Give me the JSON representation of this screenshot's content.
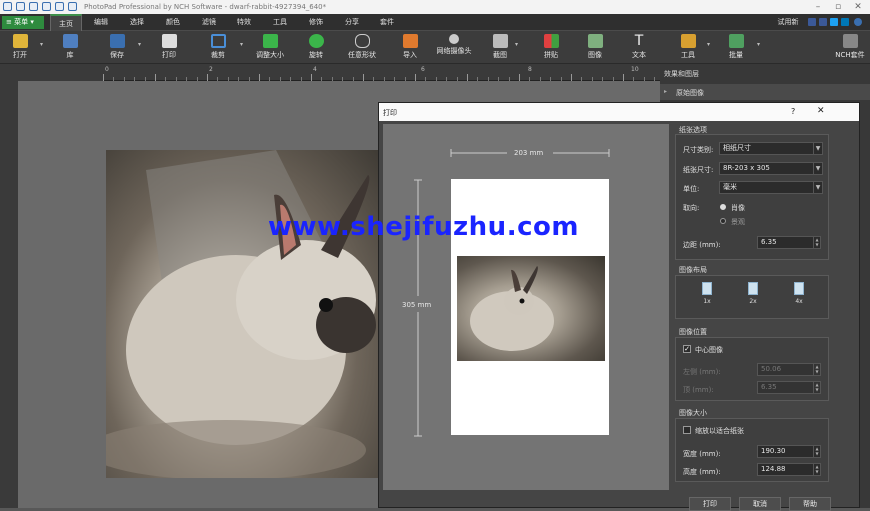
{
  "window": {
    "title": "PhotoPad Professional by NCH Software - dwarf-rabbit-4927394_640*"
  },
  "menubar": {
    "menu_label": "菜单",
    "tabs": [
      "主页",
      "编辑",
      "选择",
      "颜色",
      "滤镜",
      "特效",
      "工具",
      "修饰",
      "分享",
      "套件"
    ],
    "trial_label": "试用新"
  },
  "toolbar": {
    "open": "打开",
    "library": "库",
    "save": "保存",
    "print": "打印",
    "crop": "裁剪",
    "resize": "调整大小",
    "rotate": "旋转",
    "free_shape": "任意形状",
    "import": "导入",
    "webcam": "网络摄像头",
    "screenshot": "截图",
    "collage": "拼贴",
    "image": "图像",
    "text": "文本",
    "tools": "工具",
    "batch": "批量",
    "nch_suite": "NCH套件"
  },
  "ruler": {
    "labels": [
      "0",
      "2",
      "4",
      "6",
      "8",
      "10"
    ]
  },
  "effects_panel": {
    "title": "效果和图层",
    "original_image": "原始图像"
  },
  "dialog": {
    "title": "打印",
    "help": "?",
    "close": "✕",
    "preview": {
      "width_label": "203 mm",
      "height_label": "305 mm"
    },
    "paper_options": {
      "title": "纸张选项",
      "size_type_label": "尺寸类别:",
      "size_type_value": "相纸尺寸",
      "paper_size_label": "纸张尺寸:",
      "paper_size_value": "8R-203 x 305",
      "unit_label": "单位:",
      "unit_value": "毫米",
      "orientation_label": "取向:",
      "portrait": "肖像",
      "landscape": "景观",
      "margin_label": "边距 (mm):",
      "margin_value": "6.35"
    },
    "layout": {
      "title": "图像布局",
      "options": [
        "1x",
        "2x",
        "4x"
      ]
    },
    "position": {
      "title": "图像位置",
      "center_label": "中心图像",
      "left_label": "左侧 (mm):",
      "left_value": "50.06",
      "top_label": "顶 (mm):",
      "top_value": "6.35"
    },
    "size": {
      "title": "图像大小",
      "fit_label": "缩放以适合纸张",
      "width_label": "宽度 (mm):",
      "width_value": "190.30",
      "height_label": "高度 (mm):",
      "height_value": "124.88"
    },
    "buttons": {
      "print": "打印",
      "cancel": "取消",
      "help": "帮助"
    }
  },
  "watermark": "www.shejifuzhu.com"
}
